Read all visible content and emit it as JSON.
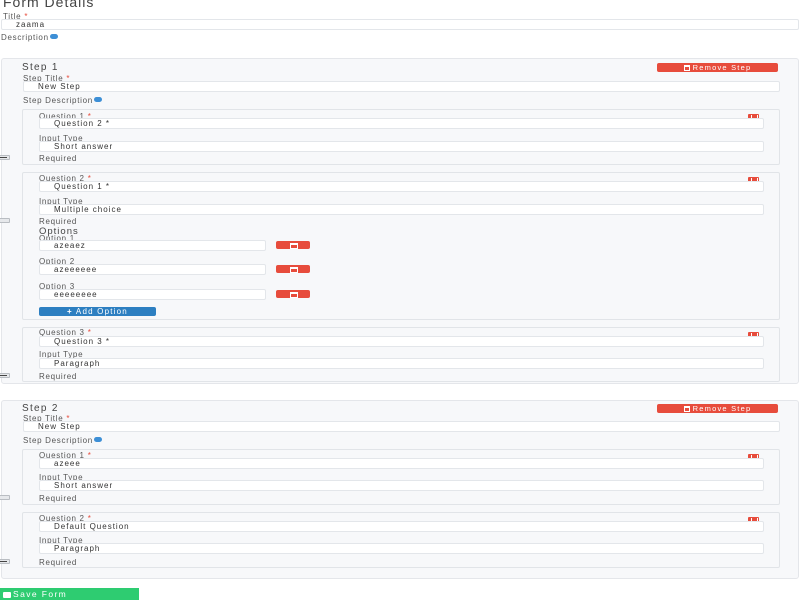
{
  "page": {
    "title": "Form Details"
  },
  "form": {
    "title_label": "Title",
    "title_value": "zaama",
    "description_label": "Description"
  },
  "labels": {
    "step_title": "Step Title",
    "step_description": "Step Description",
    "input_type": "Input Type",
    "required": "Required",
    "options": "Options",
    "remove_step": "Remove Step",
    "add_option": "Add Option",
    "save_form": "Save Form"
  },
  "steps": [
    {
      "heading": "Step 1",
      "title_value": "New Step",
      "questions": [
        {
          "label": "Question 1",
          "value": "Question 2 *",
          "input_type": "Short answer",
          "required": true
        },
        {
          "label": "Question 2",
          "value": "Question 1 *",
          "input_type": "Multiple choice",
          "required": false,
          "options": [
            {
              "label": "Option 1",
              "value": "azeaez"
            },
            {
              "label": "Option 2",
              "value": "azeeeeee"
            },
            {
              "label": "Option 3",
              "value": "eeeeeeee"
            }
          ]
        },
        {
          "label": "Question 3",
          "value": "Question 3 *",
          "input_type": "Paragraph",
          "required": true
        }
      ]
    },
    {
      "heading": "Step 2",
      "title_value": "New Step",
      "questions": [
        {
          "label": "Question 1",
          "value": "azeee",
          "input_type": "Short answer",
          "required": false
        },
        {
          "label": "Question 2",
          "value": "Default Question",
          "input_type": "Paragraph",
          "required": true
        }
      ]
    }
  ],
  "colors": {
    "danger": "#e74c3c",
    "primary": "#2d7fc1",
    "success": "#2ecc71",
    "info": "#3d8fd6"
  },
  "icons": {
    "remove_step": "trash-icon",
    "delete_question": "trash-icon",
    "delete_option": "trash-icon",
    "add_option": "plus-icon",
    "save_form": "save-icon",
    "description_help": "info-icon"
  }
}
